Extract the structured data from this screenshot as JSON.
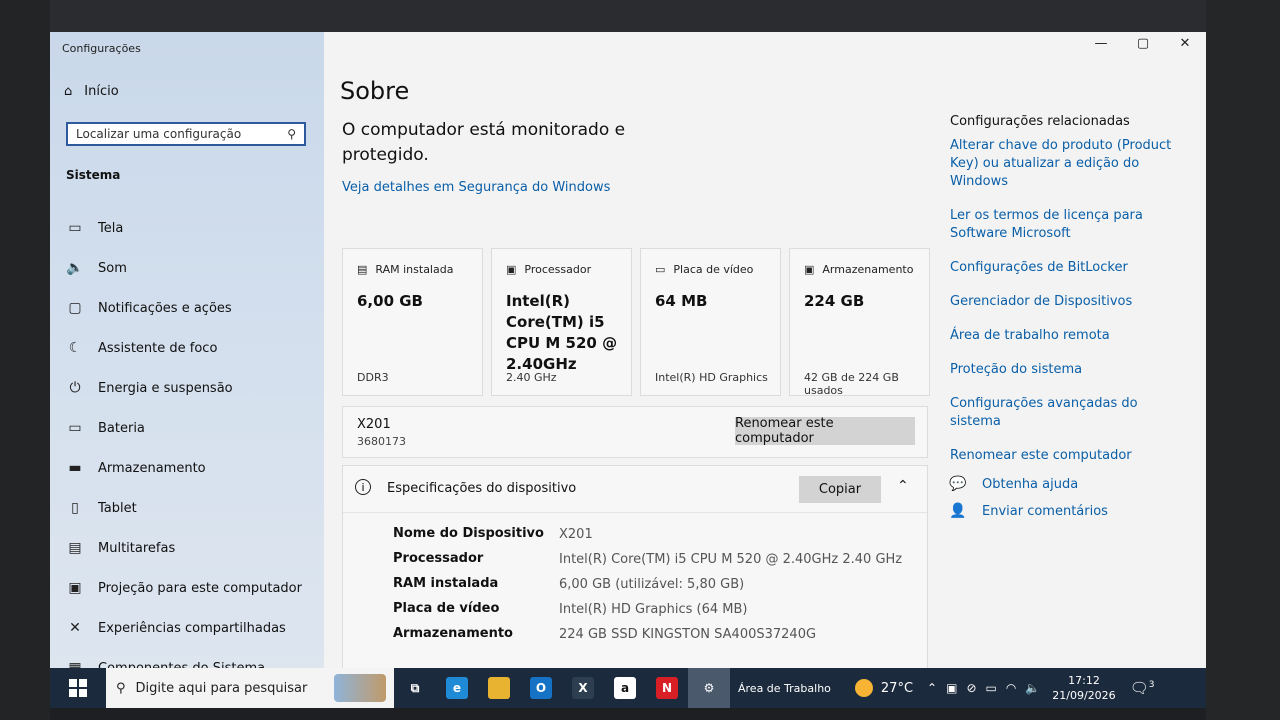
{
  "app_title": "Configurações",
  "window_controls": {
    "minimize": "—",
    "maximize": "▢",
    "close": "✕"
  },
  "sidebar": {
    "home": "Início",
    "search_placeholder": "Localizar uma configuração",
    "section": "Sistema",
    "items": [
      {
        "label": "Tela",
        "icon": "monitor-icon",
        "glyph": "▭"
      },
      {
        "label": "Som",
        "icon": "speaker-icon",
        "glyph": "🔈"
      },
      {
        "label": "Notificações e ações",
        "icon": "message-icon",
        "glyph": "▢"
      },
      {
        "label": "Assistente de foco",
        "icon": "moon-icon",
        "glyph": "☾"
      },
      {
        "label": "Energia e suspensão",
        "icon": "power-icon",
        "glyph": "⏻"
      },
      {
        "label": "Bateria",
        "icon": "battery-icon",
        "glyph": "▭"
      },
      {
        "label": "Armazenamento",
        "icon": "storage-icon",
        "glyph": "▬"
      },
      {
        "label": "Tablet",
        "icon": "tablet-icon",
        "glyph": "▯"
      },
      {
        "label": "Multitarefas",
        "icon": "multitask-icon",
        "glyph": "▤"
      },
      {
        "label": "Projeção para este computador",
        "icon": "projection-icon",
        "glyph": "▣"
      },
      {
        "label": "Experiências compartilhadas",
        "icon": "share-icon",
        "glyph": "✕"
      },
      {
        "label": "Componentes do Sistema",
        "icon": "components-icon",
        "glyph": "▦"
      }
    ]
  },
  "main": {
    "title": "Sobre",
    "protected_text": "O computador está monitorado e protegido.",
    "security_link": "Veja detalhes em Segurança do Windows",
    "cards": [
      {
        "label": "RAM instalada",
        "value": "6,00 GB",
        "sub": "DDR3",
        "icon": "ram-icon",
        "glyph": "▤"
      },
      {
        "label": "Processador",
        "value": "Intel(R) Core(TM) i5 CPU       M 520 @ 2.40GHz",
        "sub": "2.40 GHz",
        "icon": "cpu-icon",
        "glyph": "▣"
      },
      {
        "label": "Placa de vídeo",
        "value": "64 MB",
        "sub": "Intel(R) HD Graphics",
        "icon": "gpu-icon",
        "glyph": "▭"
      },
      {
        "label": "Armazenamento",
        "value": "224 GB",
        "sub": "42 GB de 224 GB usados",
        "icon": "disk-icon",
        "glyph": "▣"
      }
    ],
    "pc_name": "X201",
    "pc_id": "3680173",
    "rename_button": "Renomear este computador",
    "specs": {
      "title": "Especificações do dispositivo",
      "copy_button": "Copiar",
      "rows": [
        {
          "key": "Nome do Dispositivo",
          "value": "X201"
        },
        {
          "key": "Processador",
          "value": "Intel(R) Core(TM) i5 CPU       M 520  @ 2.40GHz   2.40 GHz"
        },
        {
          "key": "RAM instalada",
          "value": "6,00 GB (utilizável: 5,80 GB)"
        },
        {
          "key": "Placa de vídeo",
          "value": "Intel(R) HD Graphics (64 MB)"
        },
        {
          "key": "Armazenamento",
          "value": "224 GB SSD KINGSTON SA400S37240G"
        }
      ]
    }
  },
  "related": {
    "title": "Configurações relacionadas",
    "links": [
      "Alterar chave do produto (Product Key) ou atualizar a edição do Windows",
      "Ler os termos de licença para Software Microsoft",
      "Configurações de BitLocker",
      "Gerenciador de Dispositivos",
      "Área de trabalho remota",
      "Proteção do sistema",
      "Configurações avançadas do sistema",
      "Renomear este computador"
    ],
    "help": "Obtenha ajuda",
    "feedback": "Enviar comentários"
  },
  "taskbar": {
    "search": "Digite aqui para pesquisar",
    "apps": [
      {
        "name": "task-view-icon",
        "glyph": "⧉",
        "color": "#1b2a3c"
      },
      {
        "name": "edge-icon",
        "glyph": "e",
        "color": "#1f8bd6"
      },
      {
        "name": "file-explorer-icon",
        "glyph": "",
        "color": "#e8b330"
      },
      {
        "name": "outlook-icon",
        "glyph": "O",
        "color": "#1572c4"
      },
      {
        "name": "excel-x-icon",
        "glyph": "X",
        "color": "#2c3e50"
      },
      {
        "name": "amazon-icon",
        "glyph": "a",
        "color": "#ffffff"
      },
      {
        "name": "netflix-icon",
        "glyph": "N",
        "color": "#d81f26"
      },
      {
        "name": "settings-icon",
        "glyph": "⚙",
        "color": "#4a5a6c"
      }
    ],
    "desktop_label": "Área de Trabalho",
    "temperature": "27°C",
    "time": "17:12",
    "date": "21/09/2026",
    "notifications": "3"
  }
}
